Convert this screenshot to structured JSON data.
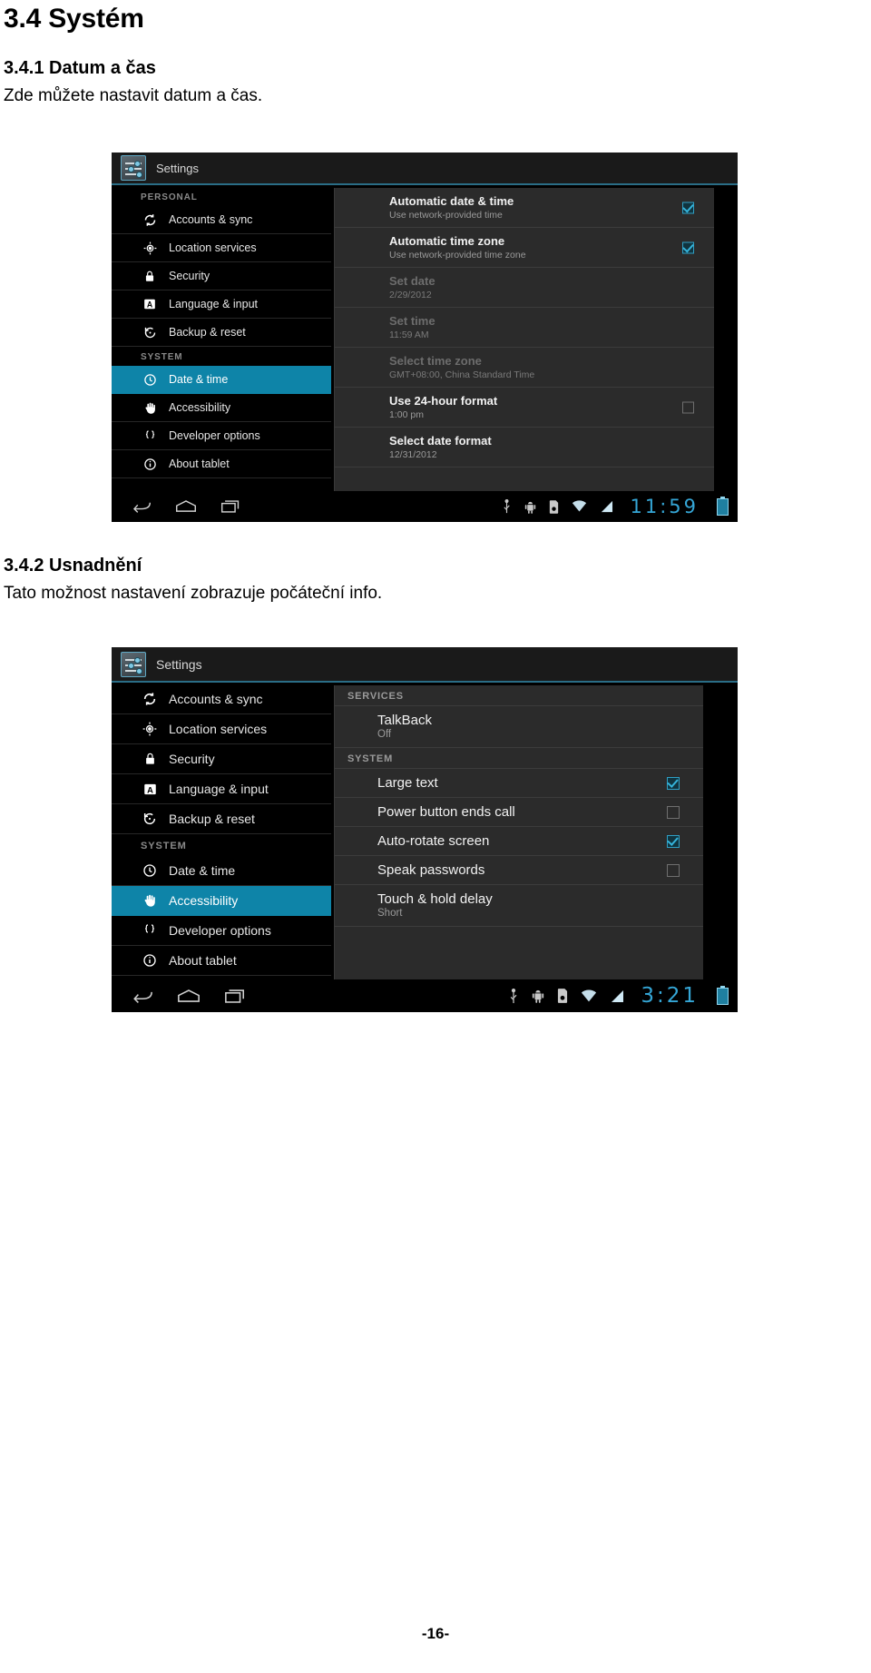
{
  "document": {
    "heading1": "3.4 Systém",
    "heading2_1": "3.4.1 Datum a čas",
    "paragraph1": "Zde můžete nastavit datum a čas.",
    "heading2_2": "3.4.2 Usnadnění",
    "paragraph2": "Tato možnost nastavení zobrazuje počáteční info.",
    "page_number": "-16-"
  },
  "screenshot_date_time": {
    "app_title": "Settings",
    "sidebar": {
      "section_personal": "PERSONAL",
      "section_system": "SYSTEM",
      "items": [
        {
          "label": "Accounts & sync",
          "icon": "sync-icon",
          "selected": false
        },
        {
          "label": "Location services",
          "icon": "location-icon",
          "selected": false
        },
        {
          "label": "Security",
          "icon": "lock-icon",
          "selected": false
        },
        {
          "label": "Language & input",
          "icon": "keyboard-letter-icon",
          "selected": false
        },
        {
          "label": "Backup & reset",
          "icon": "restore-icon",
          "selected": false
        },
        {
          "label": "Date & time",
          "icon": "clock-icon",
          "selected": true
        },
        {
          "label": "Accessibility",
          "icon": "hand-icon",
          "selected": false
        },
        {
          "label": "Developer options",
          "icon": "braces-icon",
          "selected": false
        },
        {
          "label": "About tablet",
          "icon": "info-icon",
          "selected": false
        }
      ]
    },
    "rows": [
      {
        "title": "Automatic date & time",
        "sub": "Use network-provided time",
        "checkbox": "checked",
        "disabled": false
      },
      {
        "title": "Automatic time zone",
        "sub": "Use network-provided time zone",
        "checkbox": "checked",
        "disabled": false
      },
      {
        "title": "Set date",
        "sub": "2/29/2012",
        "checkbox": "none",
        "disabled": true
      },
      {
        "title": "Set time",
        "sub": "11:59 AM",
        "checkbox": "none",
        "disabled": true
      },
      {
        "title": "Select time zone",
        "sub": "GMT+08:00, China Standard Time",
        "checkbox": "none",
        "disabled": true
      },
      {
        "title": "Use 24-hour format",
        "sub": "1:00 pm",
        "checkbox": "unchecked",
        "disabled": false
      },
      {
        "title": "Select date format",
        "sub": "12/31/2012",
        "checkbox": "none",
        "disabled": false
      }
    ],
    "statusbar": {
      "clock": "11:59",
      "icons": [
        "usb-icon",
        "android-robot-icon",
        "sdcard-icon",
        "wifi-icon",
        "signal-icon",
        "battery-icon"
      ],
      "navkeys": [
        "back-icon",
        "home-icon",
        "recents-icon"
      ]
    }
  },
  "screenshot_accessibility": {
    "app_title": "Settings",
    "sidebar": {
      "section_system": "SYSTEM",
      "items": [
        {
          "label": "Accounts & sync",
          "icon": "sync-icon",
          "selected": false
        },
        {
          "label": "Location services",
          "icon": "location-icon",
          "selected": false
        },
        {
          "label": "Security",
          "icon": "lock-icon",
          "selected": false
        },
        {
          "label": "Language & input",
          "icon": "keyboard-letter-icon",
          "selected": false
        },
        {
          "label": "Backup & reset",
          "icon": "restore-icon",
          "selected": false
        },
        {
          "label": "Date & time",
          "icon": "clock-icon",
          "selected": false
        },
        {
          "label": "Accessibility",
          "icon": "hand-icon",
          "selected": true
        },
        {
          "label": "Developer options",
          "icon": "braces-icon",
          "selected": false
        },
        {
          "label": "About tablet",
          "icon": "info-icon",
          "selected": false
        }
      ]
    },
    "group_services": "SERVICES",
    "group_system": "SYSTEM",
    "rows_services": [
      {
        "title": "TalkBack",
        "sub": "Off",
        "checkbox": "none"
      }
    ],
    "rows_system": [
      {
        "title": "Large text",
        "sub": "",
        "checkbox": "checked"
      },
      {
        "title": "Power button ends call",
        "sub": "",
        "checkbox": "unchecked"
      },
      {
        "title": "Auto-rotate screen",
        "sub": "",
        "checkbox": "checked"
      },
      {
        "title": "Speak passwords",
        "sub": "",
        "checkbox": "unchecked"
      },
      {
        "title": "Touch & hold delay",
        "sub": "Short",
        "checkbox": "none"
      }
    ],
    "statusbar": {
      "clock": "3:21",
      "icons": [
        "usb-icon",
        "android-robot-icon",
        "sdcard-icon",
        "wifi-icon",
        "signal-icon",
        "battery-icon"
      ],
      "navkeys": [
        "back-icon",
        "home-icon",
        "recents-icon"
      ]
    }
  },
  "colors": {
    "accent_blue": "#0e84a8",
    "panel_bg": "#2b2b2b",
    "sidebar_bg": "#000000",
    "clock_blue": "#35a6d6"
  }
}
